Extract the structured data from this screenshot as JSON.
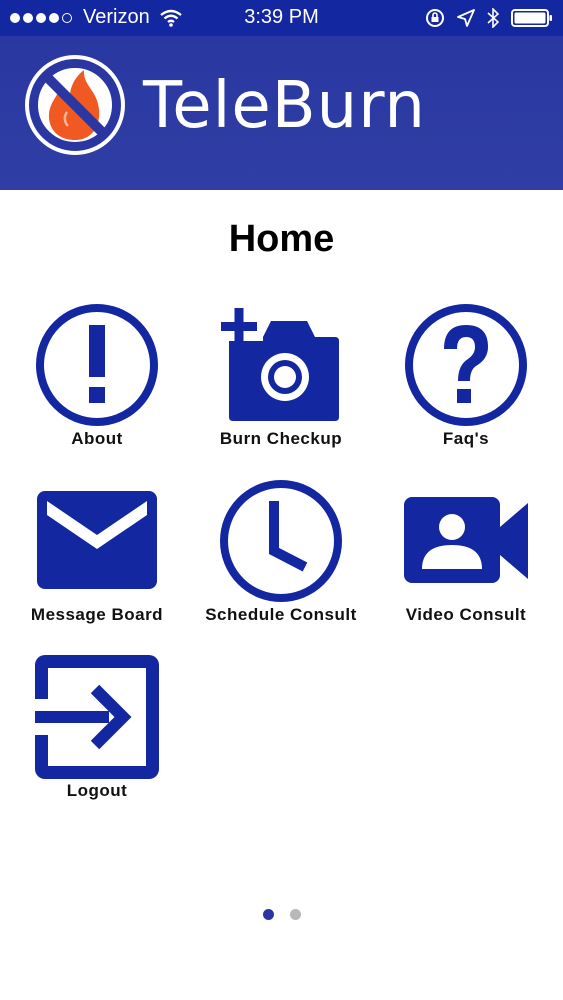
{
  "status": {
    "carrier": "Verizon",
    "time": "3:39 PM",
    "signal_bars_filled": 4,
    "signal_bars_total": 5
  },
  "header": {
    "app_title": "TeleBurn",
    "brand_color": "#2a37a2"
  },
  "page": {
    "title": "Home"
  },
  "tiles": [
    {
      "label": "About",
      "icon": "exclamation-circle-icon"
    },
    {
      "label": "Burn Checkup",
      "icon": "camera-plus-icon"
    },
    {
      "label": "Faq's",
      "icon": "question-circle-icon"
    },
    {
      "label": "Message Board",
      "icon": "envelope-icon"
    },
    {
      "label": "Schedule Consult",
      "icon": "clock-icon"
    },
    {
      "label": "Video Consult",
      "icon": "video-camera-icon"
    },
    {
      "label": "Logout",
      "icon": "logout-icon"
    }
  ],
  "pager": {
    "current_page": 1,
    "total_pages": 2
  },
  "colors": {
    "icon_fill": "#1227a0",
    "status_bar": "#1227a0",
    "flame_orange": "#f05a22",
    "pager_inactive": "#b8b8b8"
  }
}
